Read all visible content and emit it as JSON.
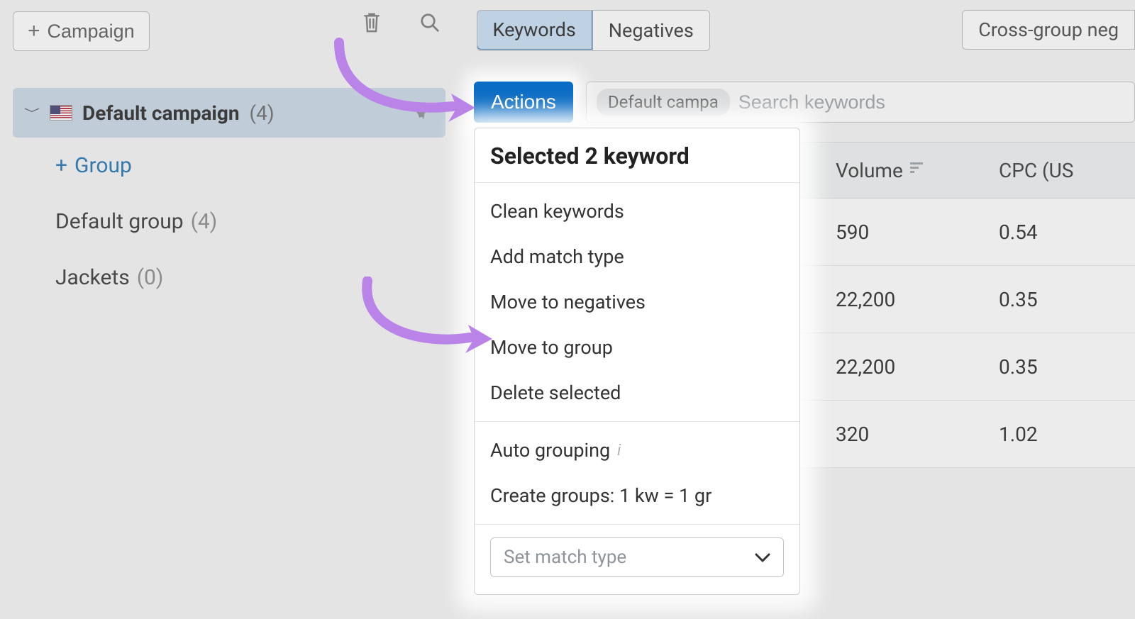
{
  "toolbar": {
    "campaign_button": "Campaign",
    "tabs": {
      "keywords": "Keywords",
      "negatives": "Negatives"
    },
    "cross_group": "Cross-group neg"
  },
  "sidebar": {
    "campaign": {
      "name": "Default campaign",
      "count": "(4)"
    },
    "add_group": "Group",
    "groups": [
      {
        "name": "Default group",
        "count": "(4)"
      },
      {
        "name": "Jackets",
        "count": "(0)"
      }
    ]
  },
  "row2": {
    "actions": "Actions",
    "chip": "Default campa",
    "search_placeholder": "Search keywords"
  },
  "table": {
    "headers": {
      "volume": "Volume",
      "cpc": "CPC (US"
    },
    "rows": [
      {
        "volume": "590",
        "cpc": "0.54"
      },
      {
        "volume": "22,200",
        "cpc": "0.35"
      },
      {
        "volume": "22,200",
        "cpc": "0.35"
      },
      {
        "volume": "320",
        "cpc": "1.02"
      }
    ]
  },
  "dropdown": {
    "title": "Selected 2 keyword",
    "items_a": [
      "Clean keywords",
      "Add match type",
      "Move to negatives",
      "Move to group",
      "Delete selected"
    ],
    "items_b": [
      "Auto grouping",
      "Create groups: 1 kw = 1 gr"
    ],
    "select_placeholder": "Set match type"
  }
}
